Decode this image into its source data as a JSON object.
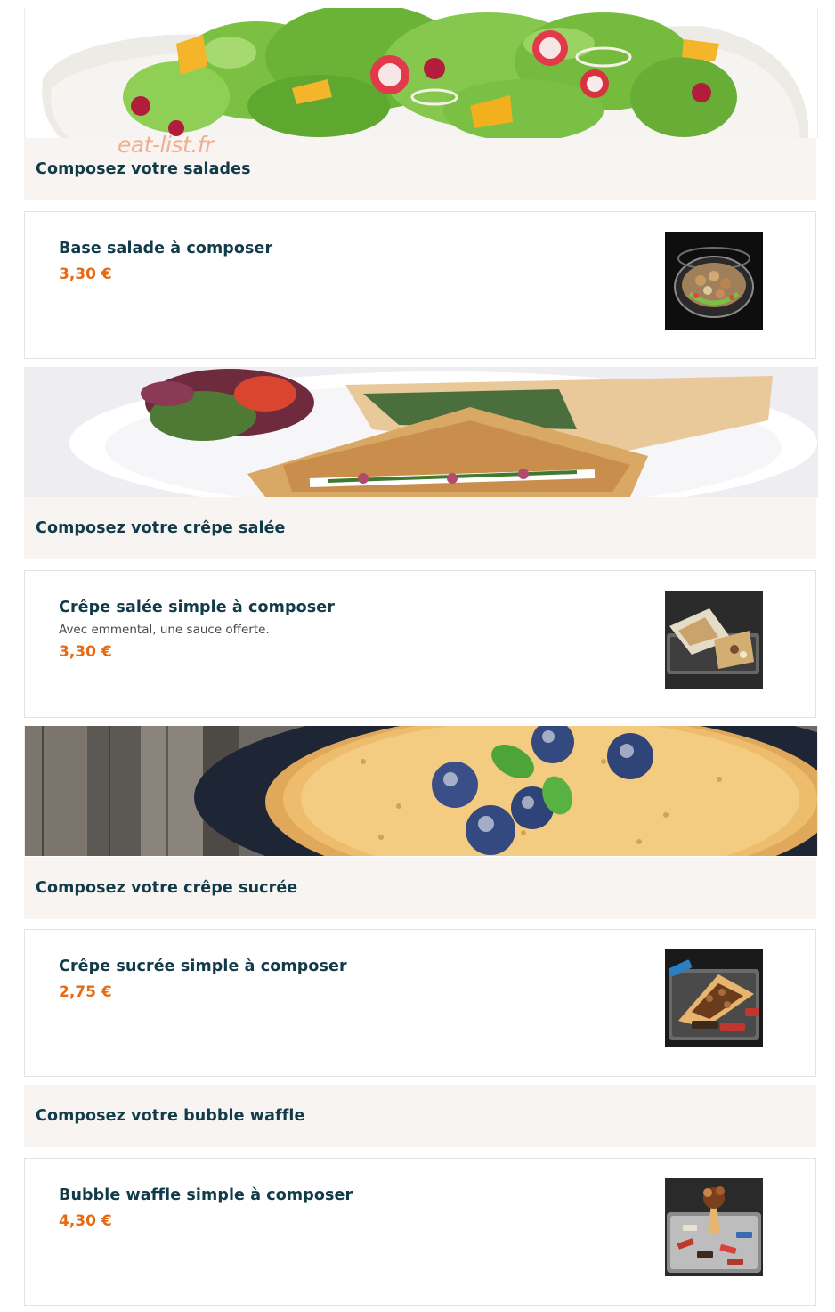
{
  "watermark": "eat-list.fr",
  "sections": [
    {
      "title": "Composez votre salades",
      "banner_icon": "salad-banner-image",
      "items": [
        {
          "name": "Base salade à composer",
          "description": "",
          "price": "3,30 €",
          "thumb_icon": "salad-bowl-photo"
        }
      ]
    },
    {
      "title": "Composez votre crêpe salée",
      "banner_icon": "savory-crepe-banner-image",
      "items": [
        {
          "name": "Crêpe salée simple à composer",
          "description": "Avec emmental, une sauce offerte.",
          "price": "3,30 €",
          "thumb_icon": "savory-crepe-photo"
        }
      ]
    },
    {
      "title": "Composez votre crêpe sucrée",
      "banner_icon": "sweet-crepe-banner-image",
      "items": [
        {
          "name": "Crêpe sucrée simple à composer",
          "description": "",
          "price": "2,75 €",
          "thumb_icon": "sweet-crepe-photo"
        }
      ]
    },
    {
      "title": "Composez votre bubble waffle",
      "banner_icon": "",
      "items": [
        {
          "name": "Bubble waffle simple à composer",
          "description": "",
          "price": "4,30 €",
          "thumb_icon": "bubble-waffle-photo"
        }
      ]
    }
  ],
  "colors": {
    "price": "#e56a12",
    "title": "#123b4a",
    "header_bg": "#f7f4f1",
    "watermark": "#f2a27e"
  }
}
